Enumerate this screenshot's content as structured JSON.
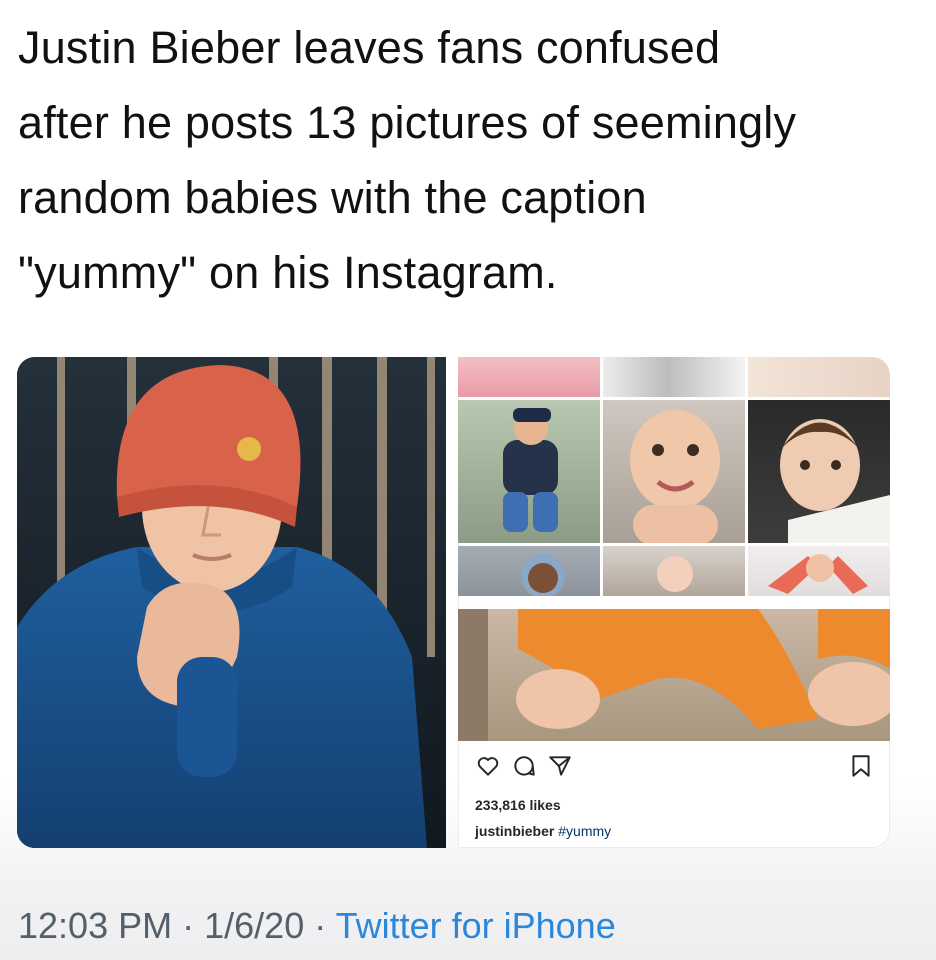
{
  "tweet": {
    "text_lines": [
      "Justin Bieber leaves fans confused",
      "after he posts 13 pictures of seemingly",
      "random babies with the caption",
      "\"yummy\" on his Instagram."
    ]
  },
  "instagram_post": {
    "likes": "233,816 likes",
    "caption_user": "justinbieber",
    "caption_hashtag": "#yummy",
    "icons": [
      "heart-icon",
      "comment-icon",
      "share-icon",
      "bookmark-icon"
    ]
  },
  "footer": {
    "time": "12:03 PM",
    "separator": "·",
    "date": "1/6/20",
    "source": "Twitter for iPhone"
  },
  "colors": {
    "link": "#2b87d9",
    "meta": "#53606c",
    "text": "#111111"
  }
}
